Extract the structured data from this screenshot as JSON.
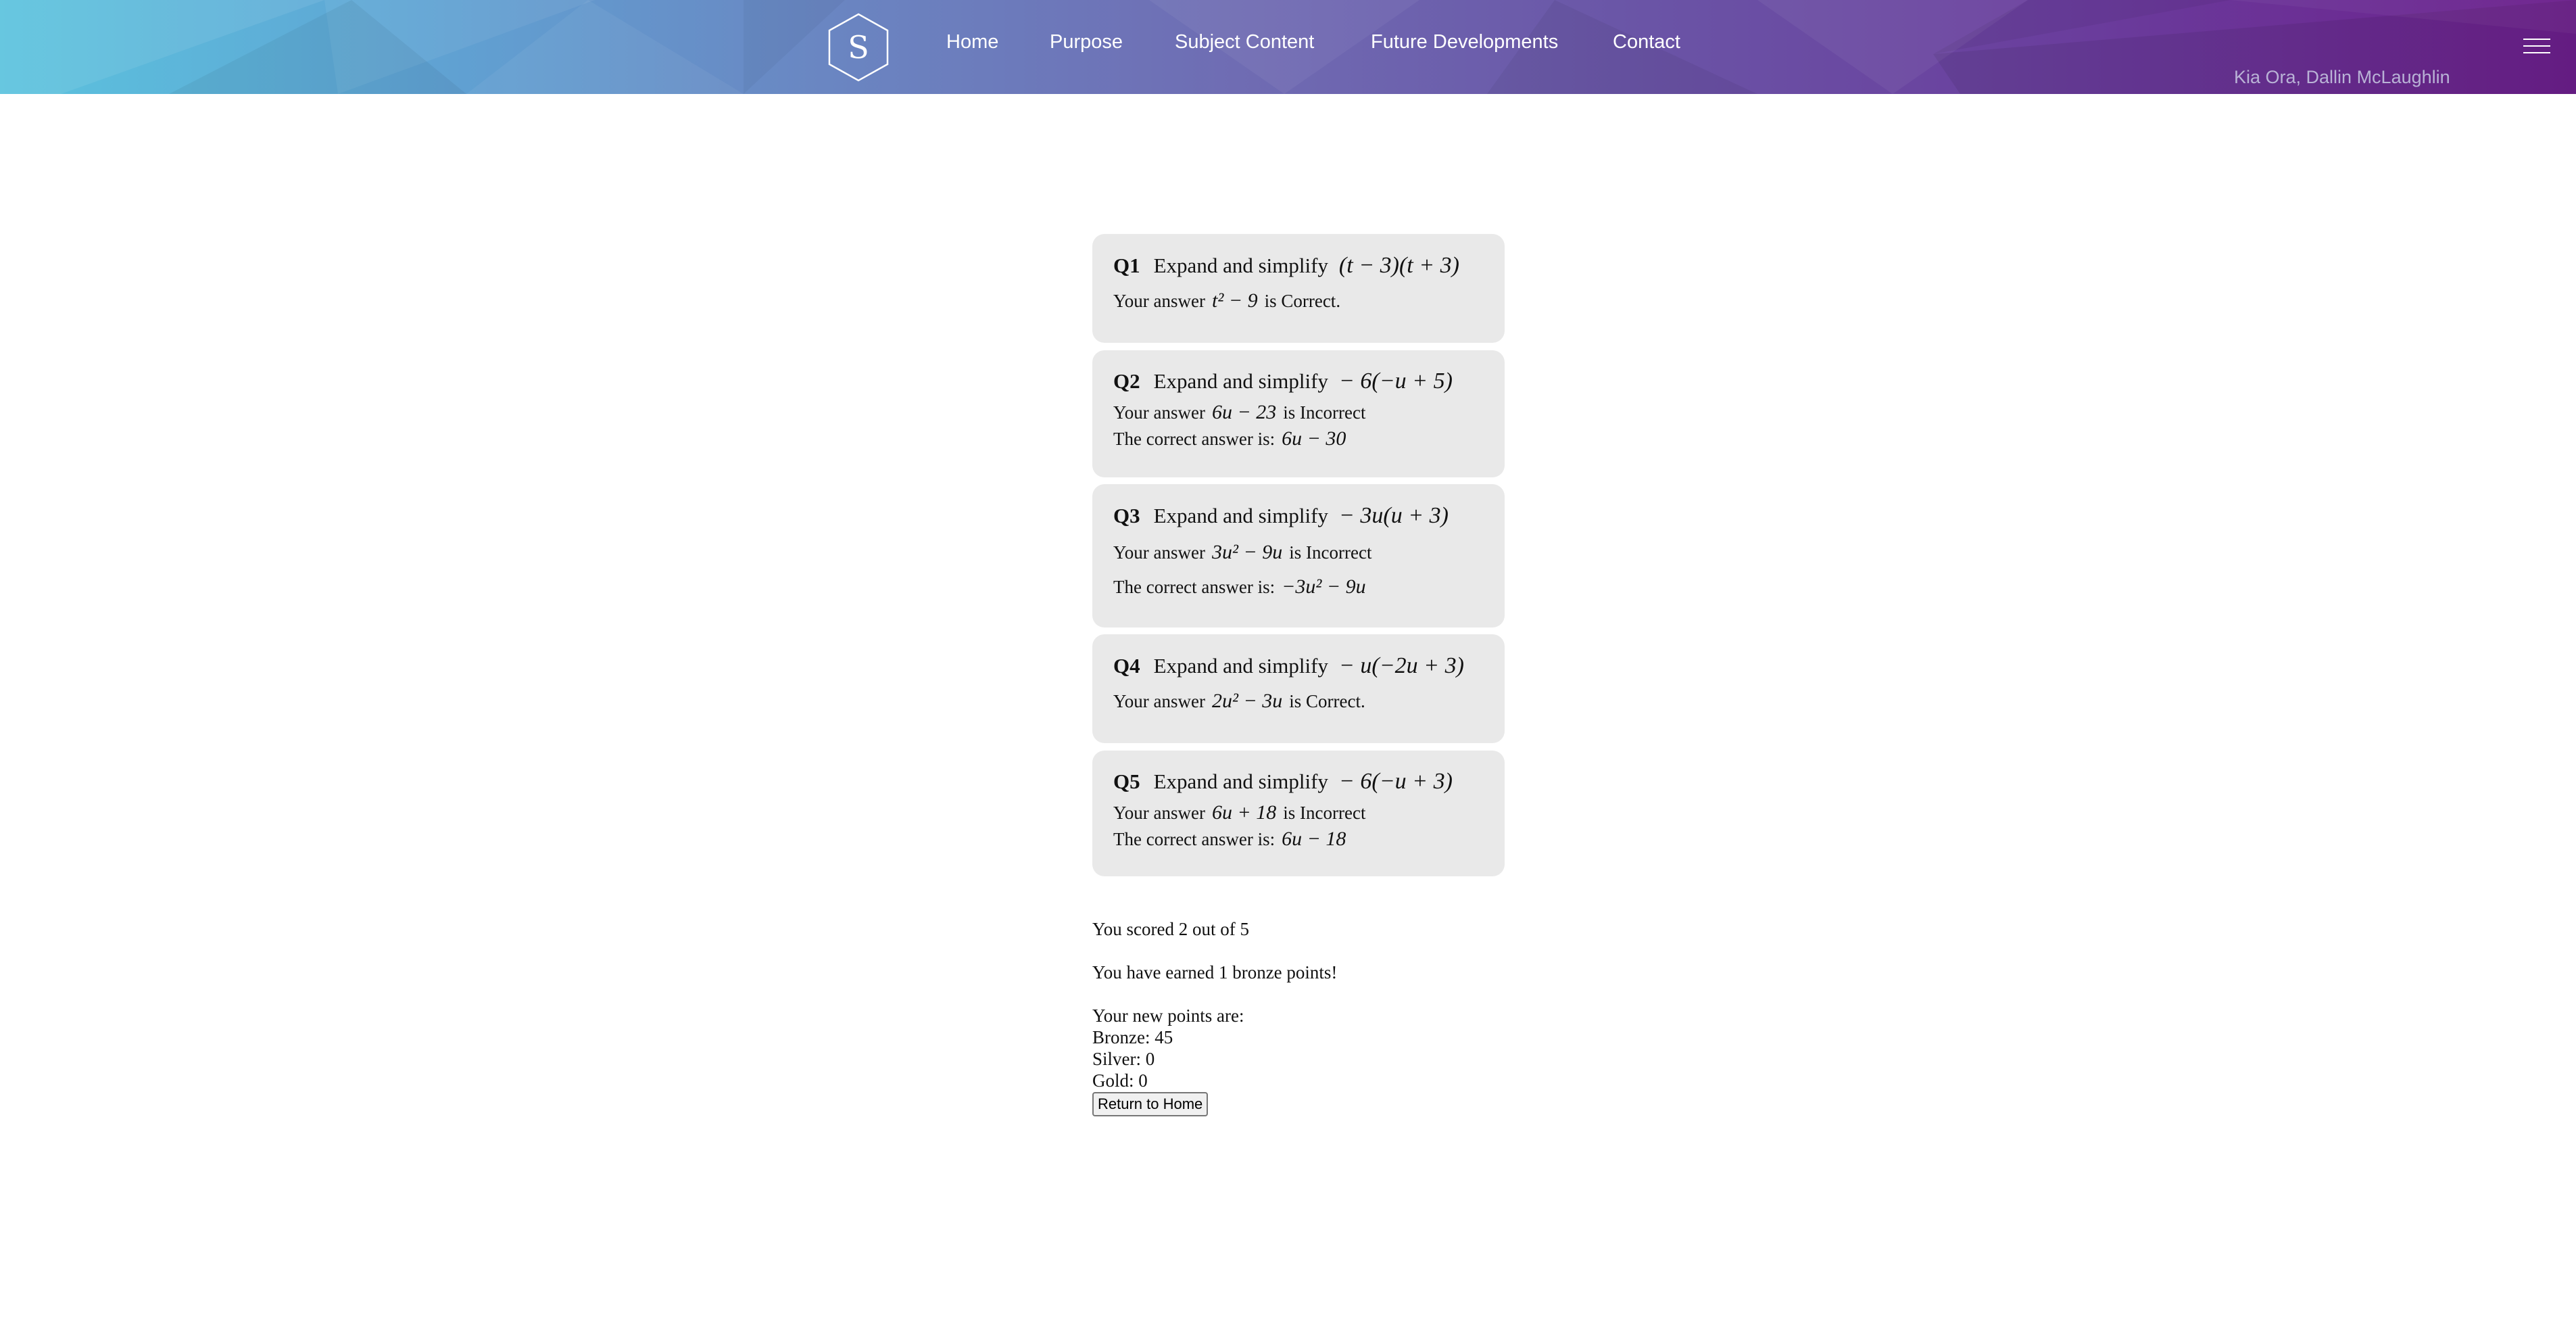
{
  "header": {
    "logo_letter": "S",
    "nav": [
      "Home",
      "Purpose",
      "Subject Content",
      "Future Developments",
      "Contact"
    ],
    "greeting": "Kia Ora, Dallin McLaughlin",
    "menu_icon": "hamburger-menu-icon"
  },
  "questions": [
    {
      "num": "Q1",
      "prompt": "Expand and simplify",
      "expression": "(t − 3)(t + 3)",
      "answer_prefix": "Your answer",
      "answer": "t² − 9",
      "verdict": "is Correct.",
      "correct_label": "",
      "correct_answer": ""
    },
    {
      "num": "Q2",
      "prompt": "Expand and simplify",
      "expression": "− 6(−u + 5)",
      "answer_prefix": "Your answer",
      "answer": "6u − 23",
      "verdict": "is Incorrect",
      "correct_label": "The correct answer is:",
      "correct_answer": "6u − 30"
    },
    {
      "num": "Q3",
      "prompt": "Expand and simplify",
      "expression": "− 3u(u + 3)",
      "answer_prefix": "Your answer",
      "answer": "3u² − 9u",
      "verdict": "is Incorrect",
      "correct_label": "The correct answer is:",
      "correct_answer": "−3u² − 9u"
    },
    {
      "num": "Q4",
      "prompt": "Expand and simplify",
      "expression": "− u(−2u + 3)",
      "answer_prefix": "Your answer",
      "answer": "2u² − 3u",
      "verdict": "is Correct.",
      "correct_label": "",
      "correct_answer": ""
    },
    {
      "num": "Q5",
      "prompt": "Expand and simplify",
      "expression": "− 6(−u + 3)",
      "answer_prefix": "Your answer",
      "answer": "6u + 18",
      "verdict": "is Incorrect",
      "correct_label": "The correct answer is:",
      "correct_answer": "6u − 18"
    }
  ],
  "summary": {
    "score": "You scored 2 out of 5",
    "earned": "You have earned 1 bronze points!",
    "new_points_heading": "Your new points are:",
    "bronze": "Bronze: 45",
    "silver": "Silver: 0",
    "gold": "Gold: 0",
    "return_button": "Return to Home"
  }
}
